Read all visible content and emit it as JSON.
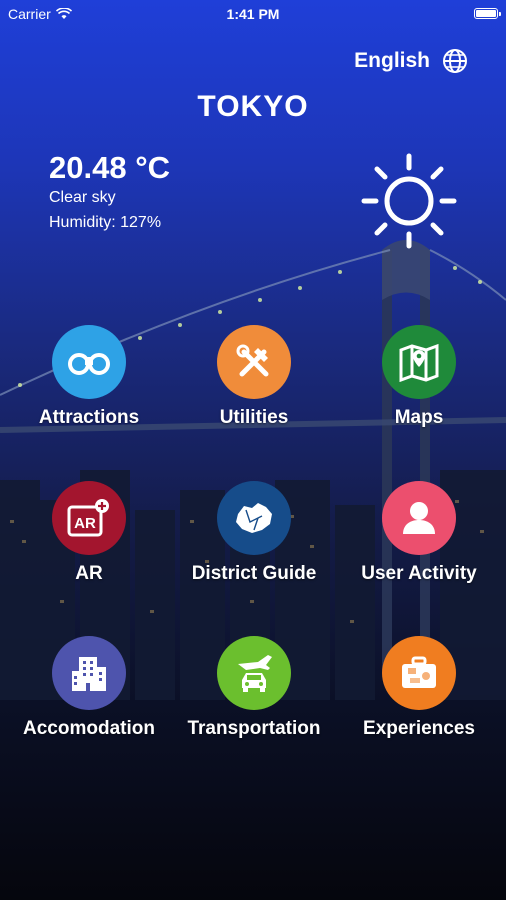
{
  "status_bar": {
    "carrier": "Carrier",
    "time": "1:41 PM"
  },
  "header": {
    "language": "English",
    "city": "TOKYO"
  },
  "weather": {
    "temperature": "20.48 °C",
    "condition": "Clear sky",
    "humidity": "Humidity: 127%",
    "icon": "sun-icon"
  },
  "menu": [
    {
      "label": "Attractions",
      "icon": "binoculars-icon",
      "color": "#2ea2e6"
    },
    {
      "label": "Utilities",
      "icon": "tools-icon",
      "color": "#f08c3a"
    },
    {
      "label": "Maps",
      "icon": "map-icon",
      "color": "#1f8a3a"
    },
    {
      "label": "AR",
      "icon": "ar-icon",
      "color": "#a3152e"
    },
    {
      "label": "District Guide",
      "icon": "district-icon",
      "color": "#164c8a"
    },
    {
      "label": "User Activity",
      "icon": "user-icon",
      "color": "#ec4f6e"
    },
    {
      "label": "Accomodation",
      "icon": "building-icon",
      "color": "#4e54ad"
    },
    {
      "label": "Transportation",
      "icon": "transport-icon",
      "color": "#6bbf2e"
    },
    {
      "label": "Experiences",
      "icon": "suitcase-icon",
      "color": "#f07d20"
    }
  ]
}
